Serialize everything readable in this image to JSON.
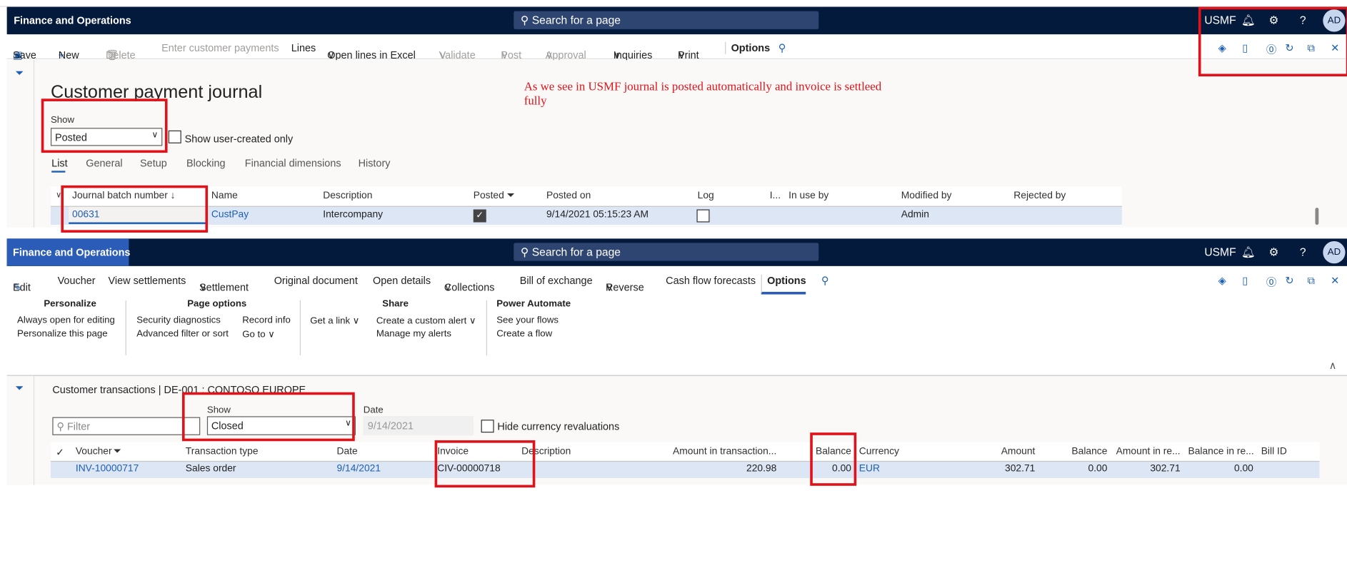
{
  "app_title": "Finance and Operations",
  "search_placeholder": "Search for a page",
  "company": "USMF",
  "avatar": "AD",
  "annotation": {
    "line1": "As we see in USMF journal is posted automatically and invoice is settleed",
    "line2": "fully",
    "color": "#e0121a"
  },
  "top": {
    "toolbar": {
      "save": "Save",
      "new": "New",
      "delete": "Delete",
      "enter_payments": "Enter customer payments",
      "lines": "Lines",
      "open_excel": "Open lines in Excel",
      "validate": "Validate",
      "post": "Post",
      "approval": "Approval",
      "inquiries": "Inquiries",
      "print": "Print",
      "options": "Options"
    },
    "page_title": "Customer payment journal",
    "show_label": "Show",
    "show_value": "Posted",
    "user_created_label": "Show user-created only",
    "tabs": [
      "List",
      "General",
      "Setup",
      "Blocking",
      "Financial dimensions",
      "History"
    ],
    "columns": [
      "Journal batch number ↓",
      "Name",
      "Description",
      "Posted",
      "Posted on",
      "Log",
      "I...",
      "In use by",
      "Modified by",
      "Rejected by"
    ],
    "row": {
      "batch": "00631",
      "name": "CustPay",
      "description": "Intercompany",
      "posted": true,
      "posted_on": "9/14/2021 05:15:23 AM",
      "log": false,
      "in_use_by": "",
      "modified_by": "Admin",
      "rejected_by": ""
    }
  },
  "bottom": {
    "toolbar": {
      "edit": "Edit",
      "voucher": "Voucher",
      "view_settlements": "View settlements",
      "settlement": "Settlement",
      "original_document": "Original document",
      "open_details": "Open details",
      "collections": "Collections",
      "bill_of_exchange": "Bill of exchange",
      "reverse": "Reverse",
      "cash_flow": "Cash flow forecasts",
      "options": "Options"
    },
    "options_panel": {
      "personalize": {
        "header": "Personalize",
        "items": [
          "Always open for editing",
          "Personalize this page"
        ]
      },
      "page_options": {
        "header": "Page options",
        "items": [
          "Security diagnostics",
          "Advanced filter or sort",
          "Record info",
          "Go to"
        ]
      },
      "share": {
        "header": "Share",
        "items": [
          "Get a link",
          "Create a custom alert",
          "Manage my alerts"
        ]
      },
      "power_automate": {
        "header": "Power Automate",
        "items": [
          "See your flows",
          "Create a flow"
        ]
      }
    },
    "breadcrumb": "Customer transactions  |  DE-001 : CONTOSO EUROPE",
    "filter_placeholder": "Filter",
    "show_label": "Show",
    "show_value": "Closed",
    "date_label": "Date",
    "date_value": "9/14/2021",
    "hide_reval_label": "Hide currency revaluations",
    "columns": [
      "Voucher",
      "Transaction type",
      "Date",
      "Invoice",
      "Description",
      "Amount in transaction...",
      "Balance",
      "Currency",
      "Amount",
      "Balance",
      "Amount in re...",
      "Balance in re...",
      "Bill ID"
    ],
    "row": [
      "INV-10000717",
      "Sales order",
      "9/14/2021",
      "CIV-00000718",
      "",
      "220.98",
      "0.00",
      "EUR",
      "302.71",
      "0.00",
      "302.71",
      "0.00",
      ""
    ]
  }
}
